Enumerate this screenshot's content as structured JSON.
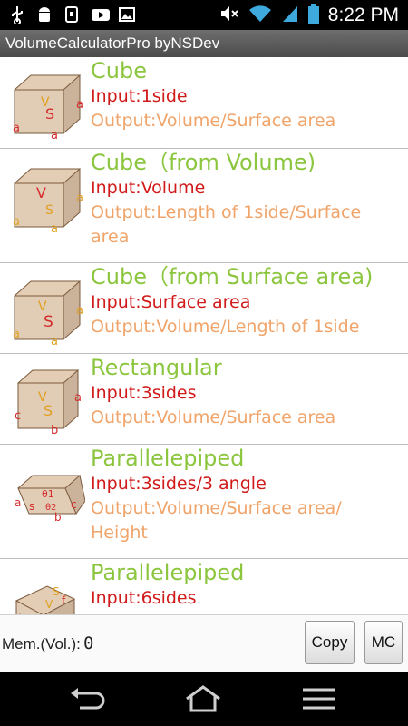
{
  "status": {
    "time": "8:22 PM",
    "left_icons": [
      "usb-icon",
      "android-icon",
      "nfc-icon",
      "youtube-icon",
      "photo-icon"
    ],
    "right_icons": [
      "mute-icon",
      "wifi-icon",
      "signal-icon",
      "battery-icon"
    ]
  },
  "app": {
    "title": "VolumeCalculatorPro byNSDev"
  },
  "list": {
    "items": [
      {
        "title": "Cube",
        "input": "Input:1side",
        "output": "Output:Volume/Surface area",
        "output2": ""
      },
      {
        "title": "Cube（from Volume)",
        "input": "Input:Volume",
        "output": "Output:Length of 1side/Surface",
        "output2": "area"
      },
      {
        "title": "Cube（from Surface area)",
        "input": "Input:Surface area",
        "output": "Output:Volume/Length of 1side",
        "output2": ""
      },
      {
        "title": "Rectangular",
        "input": "Input:3sides",
        "output": "Output:Volume/Surface area",
        "output2": ""
      },
      {
        "title": "Parallelepiped",
        "input": "Input:3sides/3 angle",
        "output": "Output:Volume/Surface area/",
        "output2": "Height"
      },
      {
        "title": "Parallelepiped",
        "input": "Input:6sides",
        "output": "",
        "output2": ""
      }
    ]
  },
  "memory": {
    "label": "Mem.(Vol.):",
    "value": "0"
  },
  "buttons": {
    "copy": "Copy",
    "mc": "MC"
  },
  "nav": [
    "back-icon",
    "home-icon",
    "menu-icon"
  ],
  "colors": {
    "title": "#8cc63f",
    "input": "#d11a1a",
    "output": "#f0a46a",
    "box": "#c9a27a"
  }
}
